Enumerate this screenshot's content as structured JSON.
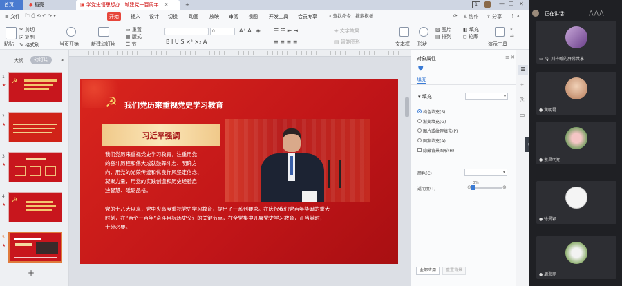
{
  "tabs": {
    "home": "首页",
    "wps": "稻壳",
    "doc": "学党史悟思想办...城建党一百周年"
  },
  "window": {
    "page_badge": "1",
    "buttons": [
      "—",
      "❐",
      "✕"
    ]
  },
  "menubar": {
    "file": "文件",
    "items": [
      "开始",
      "插入",
      "设计",
      "切换",
      "动画",
      "放映",
      "审阅",
      "视图",
      "开发工具",
      "会员专享"
    ],
    "search": "查找命令、搜索模板",
    "collab": "协作",
    "share": "分享"
  },
  "ribbon": {
    "cut": "剪切",
    "copy": "复制",
    "format_painter": "格式刷",
    "paste": "粘贴",
    "play": "当页开始",
    "new_slide": "新建幻灯片",
    "layout": "版式",
    "section": "节",
    "reset": "重置",
    "font_size": "0",
    "text_box": "文本框",
    "shape": "形状",
    "arrange": "排列",
    "image": "图片",
    "fill": "填充",
    "outline": "轮廓",
    "present": "演示工具",
    "replace": "替换",
    "smart_shape": "智能图形",
    "text_effect": "文字效果",
    "convert": "转换图形"
  },
  "leftpane": {
    "outline_tab": "大纲",
    "slides_tab": "幻灯片",
    "slide_numbers": [
      "1",
      "2",
      "3",
      "4",
      "5"
    ],
    "add": "+"
  },
  "slide": {
    "title": "我们党历来重视党史学习教育",
    "banner": "习近平强调",
    "para1_lines": [
      "我们党历来重视党史学习教育，注重用党",
      "的奋斗历程和伟大成就鼓舞斗志、明确方",
      "向，用党的光荣传统和优良作风坚定信念、",
      "凝聚力量，用党的实践创造和历史经验启",
      "迪智慧、砥砺品格。"
    ],
    "para2_lines": [
      "党的十八大以来，党中央高度重视党史学习教育，提出了一系列要求。在庆祝我们党百年华诞的重大",
      "时刻，在“两个一百年”奋斗目标历史交汇的关键节点，在全党集中开展党史学习教育，正当其时，",
      "十分必要。"
    ]
  },
  "rightpane": {
    "title": "对象属性",
    "fill_tab": "填充",
    "fill_section": "填充",
    "options": [
      "纯色填充(S)",
      "渐变填充(G)",
      "图片或纹理填充(P)",
      "图案填充(A)"
    ],
    "hide_bg": "隐藏背景图形(H)",
    "color_label": "颜色(C)",
    "transparency_label": "透明度(T)",
    "transparency_value": "0%",
    "apply_all": "全部应用",
    "reset_bg": "重置背景"
  },
  "meeting": {
    "speaking_label": "正在讲话:",
    "sharing_label": "刘梓翰的屏幕共享",
    "participants": [
      "黄明磊",
      "蔡昌明翔",
      "徐旻颖",
      "周海丽"
    ]
  },
  "colors": {
    "accent": "#e6463b",
    "slide_red": "#c91a1a",
    "banner_gold": "#f5d9a0"
  }
}
